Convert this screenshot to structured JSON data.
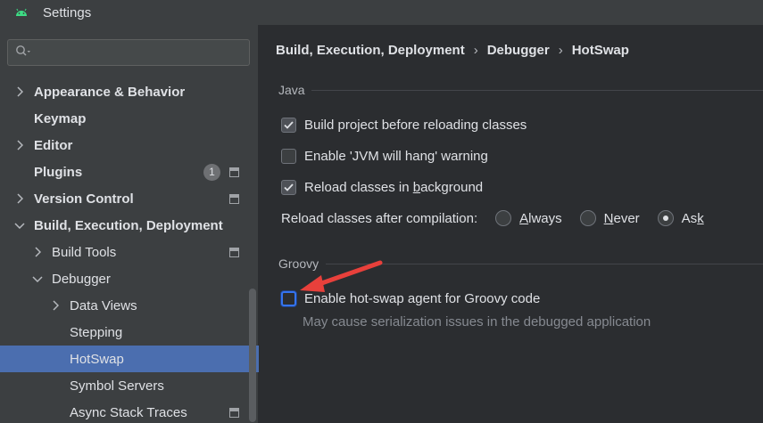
{
  "window": {
    "title": "Settings"
  },
  "search": {
    "placeholder": ""
  },
  "sidebar": {
    "items": [
      {
        "label": "Appearance & Behavior",
        "arrow": "right",
        "bold": true
      },
      {
        "label": "Keymap",
        "arrow": "none",
        "bold": true
      },
      {
        "label": "Editor",
        "arrow": "right",
        "bold": true
      },
      {
        "label": "Plugins",
        "arrow": "none",
        "bold": true,
        "badge": "1"
      },
      {
        "label": "Version Control",
        "arrow": "right",
        "bold": true
      },
      {
        "label": "Build, Execution, Deployment",
        "arrow": "down",
        "bold": true
      },
      {
        "label": "Build Tools",
        "arrow": "right",
        "bold": false
      },
      {
        "label": "Debugger",
        "arrow": "down",
        "bold": false
      },
      {
        "label": "Data Views",
        "arrow": "right",
        "bold": false
      },
      {
        "label": "Stepping",
        "arrow": "none",
        "bold": false
      },
      {
        "label": "HotSwap",
        "arrow": "none",
        "bold": false,
        "selected": true
      },
      {
        "label": "Symbol Servers",
        "arrow": "none",
        "bold": false
      },
      {
        "label": "Async Stack Traces",
        "arrow": "none",
        "bold": false
      }
    ]
  },
  "breadcrumb": {
    "part1": "Build, Execution, Deployment",
    "part2": "Debugger",
    "part3": "HotSwap",
    "separator": "›"
  },
  "java": {
    "title": "Java",
    "build_before_reload": {
      "label": "Build project before reloading classes",
      "checked": true
    },
    "jvm_hang_warning": {
      "label": "Enable 'JVM will hang' warning",
      "checked": false
    },
    "reload_background": {
      "label_pre": "Reload classes in ",
      "label_u": "b",
      "label_post": "ackground",
      "checked": true
    },
    "reload_after": {
      "label": "Reload classes after compilation:",
      "always": {
        "u": "A",
        "rest": "lways"
      },
      "never": {
        "u": "N",
        "rest": "ever"
      },
      "ask": {
        "pre": "As",
        "u": "k"
      },
      "selected": "Ask"
    }
  },
  "groovy": {
    "title": "Groovy",
    "hotswap_agent": {
      "label": "Enable hot-swap agent for Groovy code",
      "checked": false
    },
    "hint": "May cause serialization issues in the debugged application"
  },
  "colors": {
    "selection": "#4b6eaf",
    "annotation_arrow": "#e8403b",
    "focus": "#3574f0"
  }
}
